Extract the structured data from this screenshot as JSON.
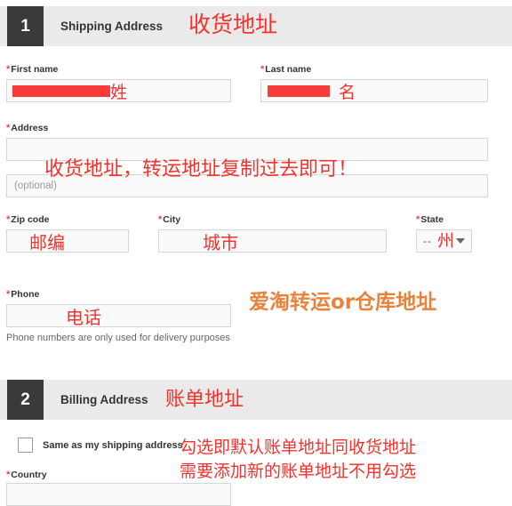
{
  "steps": [
    {
      "number": "1",
      "title": "Shipping Address",
      "annotation": "收货地址"
    },
    {
      "number": "2",
      "title": "Billing Address",
      "annotation": "账单地址"
    }
  ],
  "shipping": {
    "first_name": {
      "label": "First name",
      "required_mark": "*",
      "value": "",
      "annotation": "姓"
    },
    "last_name": {
      "label": "Last name",
      "required_mark": "*",
      "value": "",
      "annotation": "名"
    },
    "address": {
      "label": "Address",
      "required_mark": "*",
      "value": "",
      "annotation": "收货地址，转运地址复制过去即可！"
    },
    "address2": {
      "placeholder": "(optional)",
      "value": ""
    },
    "zip": {
      "label": "Zip code",
      "required_mark": "*",
      "value": "",
      "annotation": "邮编"
    },
    "city": {
      "label": "City",
      "required_mark": "*",
      "value": "",
      "annotation": "城市"
    },
    "state": {
      "label": "State",
      "required_mark": "*",
      "selected": "--",
      "annotation": "州"
    },
    "phone": {
      "label": "Phone",
      "required_mark": "*",
      "value": "",
      "annotation": "电话",
      "helper": "Phone numbers are only used for delivery purposes"
    },
    "side_annotation": "爱淘转运or仓库地址"
  },
  "billing": {
    "same_as_shipping": {
      "label": "Same as my shipping address",
      "checked": false,
      "annotation_line1": "勾选即默认账单地址同收货地址",
      "annotation_line2": "需要添加新的账单地址不用勾选"
    },
    "country": {
      "label": "Country",
      "required_mark": "*",
      "selected": ""
    }
  },
  "colors": {
    "annotation_red": "#f5322c",
    "annotation_orange": "#e8823c",
    "step_box": "#3a3a3a",
    "header_band": "#eaeaea",
    "required_star": "#e8453c",
    "redaction": "#f93b3b"
  }
}
